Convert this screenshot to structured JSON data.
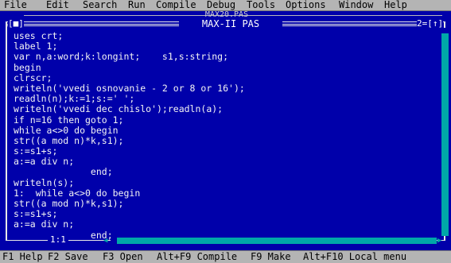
{
  "menu": {
    "items": [
      "File",
      "Edit",
      "Search",
      "Run",
      "Compile",
      "Debug",
      "Tools",
      "Options",
      "Window",
      "Help"
    ]
  },
  "windows": {
    "background_title": "MAX20.PAS",
    "close_box": "[■]",
    "active_title": "MAX-II PAS",
    "window_number": "2=[↑]"
  },
  "editor": {
    "lines": [
      "uses crt;",
      "label 1;",
      "var n,a:word;k:longint;    s1,s:string;",
      "begin",
      "clrscr;",
      "writeln('vvedi osnovanie - 2 or 8 or 16');",
      "readln(n);k:=1;s:=' ';",
      "writeln('vvedi dec chislo');readln(a);",
      "if n=16 then goto 1;",
      "while a<>0 do begin",
      "str((a mod n)*k,s1);",
      "s:=s1+s;",
      "a:=a div n;",
      "              end;",
      "writeln(s);",
      "1:  while a<>0 do begin",
      "str((a mod n)*k,s1);",
      "s:=s1+s;",
      "a:=a div n;",
      "              end;"
    ]
  },
  "status": {
    "cursor_position": "1:1"
  },
  "hints": {
    "items": [
      "F1 Help",
      "F2 Save",
      "F3 Open",
      "Alt+F9 Compile",
      "F9 Make",
      "Alt+F10 Local menu"
    ]
  },
  "colors": {
    "editor_background": "#0000aa",
    "editor_text": "#ffffff",
    "menu_background": "#b4b4b4",
    "scrollbar": "#00a8a8"
  }
}
